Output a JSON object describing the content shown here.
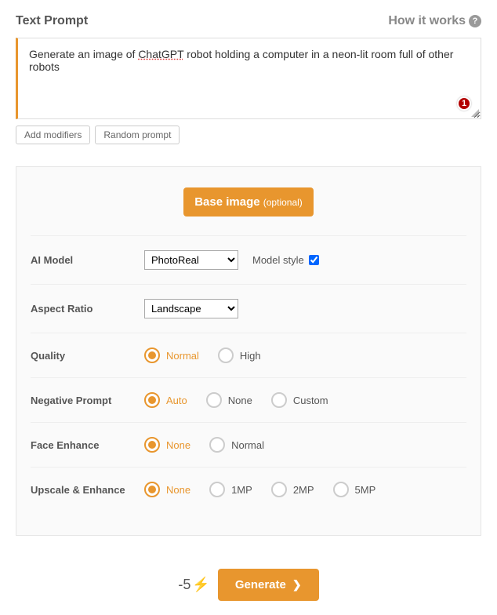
{
  "header": {
    "title": "Text Prompt",
    "how_it_works": "How it works"
  },
  "prompt": {
    "text_before": "Generate an image of ",
    "text_spell": "ChatGPT",
    "text_after": " robot holding a computer in a neon-lit room full of other robots",
    "badge": "1"
  },
  "buttons": {
    "add_modifiers": "Add modifiers",
    "random_prompt": "Random prompt",
    "base_image": "Base image",
    "base_image_opt": "(optional)",
    "generate": "Generate"
  },
  "settings": {
    "ai_model": {
      "label": "AI Model",
      "value": "PhotoReal",
      "model_style_label": "Model style",
      "model_style_checked": true
    },
    "aspect_ratio": {
      "label": "Aspect Ratio",
      "value": "Landscape"
    },
    "quality": {
      "label": "Quality",
      "options": [
        "Normal",
        "High"
      ],
      "selected": "Normal"
    },
    "negative_prompt": {
      "label": "Negative Prompt",
      "options": [
        "Auto",
        "None",
        "Custom"
      ],
      "selected": "Auto"
    },
    "face_enhance": {
      "label": "Face Enhance",
      "options": [
        "None",
        "Normal"
      ],
      "selected": "None"
    },
    "upscale": {
      "label": "Upscale & Enhance",
      "options": [
        "None",
        "1MP",
        "2MP",
        "5MP"
      ],
      "selected": "None"
    }
  },
  "footer": {
    "cost": "-5"
  }
}
